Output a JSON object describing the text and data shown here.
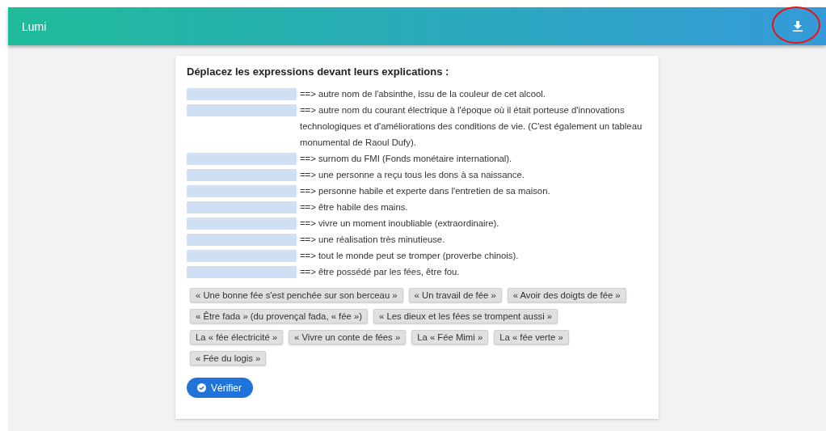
{
  "app_bar": {
    "title": "Lumi",
    "download_highlighted": true
  },
  "exercise": {
    "instruction": "Déplacez les expressions devant leurs explications :",
    "items": [
      {
        "explanation": "==> autre nom de l'absinthe, issu de la couleur de cet alcool."
      },
      {
        "explanation": "==> autre nom du courant électrique à l'époque où il était porteuse d'innovations technologiques et d'améliorations des conditions de vie. (C'est également un tableau monumental de Raoul Dufy)."
      },
      {
        "explanation": "==> surnom du FMI (Fonds monétaire international)."
      },
      {
        "explanation": "==> une personne a reçu tous les dons à sa naissance."
      },
      {
        "explanation": "==> personne habile et experte dans l'entretien de sa maison."
      },
      {
        "explanation": "==> être habile des mains."
      },
      {
        "explanation": "==> vivre un moment inoubliable (extraordinaire)."
      },
      {
        "explanation": "==> une réalisation très minutieuse."
      },
      {
        "explanation": "==> tout le monde peut se tromper (proverbe chinois)."
      },
      {
        "explanation": "==> être possédé par les fées, être fou."
      }
    ],
    "expressions": [
      "« Une bonne fée s'est penchée sur son berceau »",
      "« Un travail de fée »",
      "« Avoir des doigts de fée »",
      "« Être fada » (du provençal fada, « fée »)",
      "« Les dieux et les fées se trompent aussi »",
      "La « fée électricité »",
      "« Vivre un conte de fées »",
      "La « Fée Mimi »",
      "La « fée verte »",
      "« Fée du logis »"
    ],
    "check_button": "Vérifier"
  }
}
